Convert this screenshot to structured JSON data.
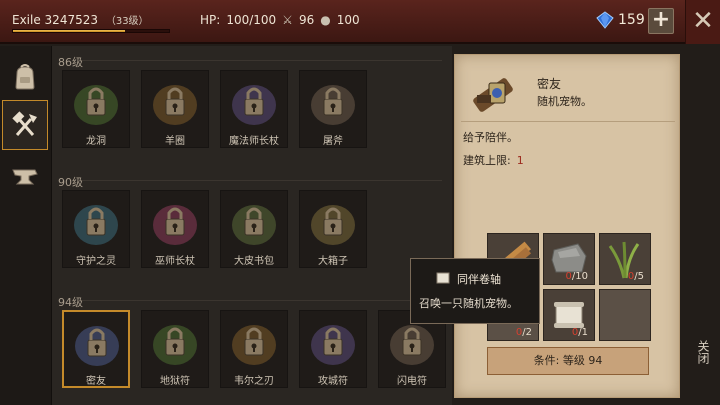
{
  "player": {
    "name": "Exile 3247523",
    "level": "（33级）",
    "xp_progress": 0.72
  },
  "stats": {
    "hp_label": "HP:",
    "hp_value": "100/100",
    "attack_value": "96",
    "water_value": "100"
  },
  "currency": {
    "gem_count": "159",
    "add_icon": "plus-icon"
  },
  "window": {
    "close_icon": "close-x-icon",
    "close_label": "关闭"
  },
  "tabs": [
    {
      "name": "backpack",
      "icon": "backpack-icon",
      "active": false
    },
    {
      "name": "crafting",
      "icon": "hammer-axe-icon",
      "active": true
    },
    {
      "name": "anvil",
      "icon": "anvil-icon",
      "active": false
    }
  ],
  "sections": [
    {
      "label": "86级",
      "items": [
        "龙洞",
        "羊圈",
        "魔法师长杖",
        "屠斧"
      ]
    },
    {
      "label": "90级",
      "items": [
        "守护之灵",
        "巫师长杖",
        "大皮书包",
        "大箱子"
      ]
    },
    {
      "label": "94级",
      "items": [
        "密友",
        "地狱符",
        "韦尔之刃",
        "攻城符",
        "闪电符"
      ]
    }
  ],
  "selected_item": "密友",
  "detail": {
    "name": "密友",
    "subtitle": "随机宠物。",
    "description": "给予陪伴。",
    "build_limit_label": "建筑上限:",
    "build_limit_value": "1",
    "resources": [
      {
        "icon": "plank-icon",
        "have": "",
        "need": "14"
      },
      {
        "icon": "stone-icon",
        "have": "0",
        "need": "10"
      },
      {
        "icon": "herb-icon",
        "have": "0",
        "need": "5"
      },
      {
        "icon": "empty",
        "have": "0",
        "need": "2"
      },
      {
        "icon": "scroll-icon",
        "have": "0",
        "need": "1"
      },
      {
        "icon": "empty",
        "have": "",
        "need": ""
      }
    ],
    "condition_label": "条件: 等级 94"
  },
  "tooltip": {
    "title": "同伴卷轴",
    "description": "召唤一只随机宠物。"
  }
}
